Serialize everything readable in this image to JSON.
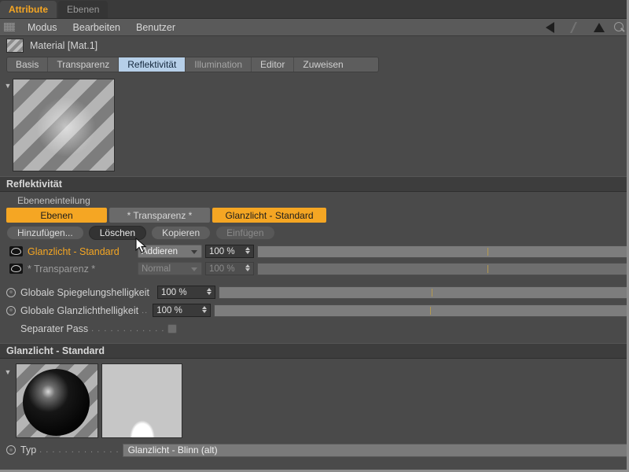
{
  "window": {
    "manager_tabs": [
      {
        "label": "Attribute",
        "active": true
      },
      {
        "label": "Ebenen",
        "active": false
      }
    ]
  },
  "menubar": {
    "grip_icon": "dotted-grip-icon",
    "items": [
      "Modus",
      "Bearbeiten",
      "Benutzer"
    ],
    "right_icons": [
      "triangle-left-icon",
      "ghost-triangle-icon",
      "triangle-up-icon",
      "search-icon"
    ]
  },
  "object_header": {
    "swatch_icon": "material-swatch-icon",
    "title": "Material [Mat.1]"
  },
  "attribute_tabs": [
    {
      "label": "Basis",
      "state": "normal"
    },
    {
      "label": "Transparenz",
      "state": "normal"
    },
    {
      "label": "Reflektivität",
      "state": "selected"
    },
    {
      "label": "Illumination",
      "state": "dim"
    },
    {
      "label": "Editor",
      "state": "normal"
    },
    {
      "label": "Zuweisen",
      "state": "normal"
    }
  ],
  "preview": {
    "caret_icon": "caret-down-icon",
    "thumbnail_name": "material-preview-thumbnail"
  },
  "reflectivity": {
    "section_title": "Reflektivität",
    "layering_label": "Ebeneneinteilung",
    "segments": [
      {
        "label": "Ebenen",
        "style": "orange"
      },
      {
        "label": "* Transparenz *",
        "style": "gray"
      },
      {
        "label": "Glanzlicht - Standard",
        "style": "orange"
      }
    ],
    "buttons": [
      {
        "label": "Hinzufügen...",
        "state": "normal"
      },
      {
        "label": "Löschen",
        "state": "hover"
      },
      {
        "label": "Kopieren",
        "state": "normal"
      },
      {
        "label": "Einfügen",
        "state": "disabled"
      }
    ],
    "layers": [
      {
        "visibility_icon": "eye-icon",
        "name": "Glanzlicht - Standard",
        "name_state": "active",
        "blend_mode": "Addieren",
        "blend_state": "enabled",
        "opacity": "100 %",
        "opacity_state": "enabled"
      },
      {
        "visibility_icon": "eye-icon",
        "name": "* Transparenz *",
        "name_state": "inactive",
        "blend_mode": "Normal",
        "blend_state": "disabled",
        "opacity": "100 %",
        "opacity_state": "disabled"
      }
    ],
    "globals": [
      {
        "label": "Globale Spiegelungshelligkeit",
        "value": "100 %",
        "dots": ""
      },
      {
        "label": "Globale Glanzlichthelligkeit",
        "value": "100 %",
        "dots": ".."
      }
    ],
    "separate_pass": {
      "label": "Separater Pass",
      "dots": ". . . . . . . . . . . .",
      "checked": false
    }
  },
  "specular": {
    "section_title": "Glanzlicht - Standard",
    "caret_icon": "caret-down-icon",
    "sphere_preview_name": "specular-sphere-preview",
    "curve_preview_name": "specular-falloff-curve",
    "type_row": {
      "label": "Typ",
      "dots": ". . . . . . . . . . . . .",
      "value": "Glanzlicht - Blinn (alt)"
    }
  },
  "colors": {
    "accent_orange": "#f5a623",
    "tab_selected_blue": "#b6cfe8",
    "panel_bg": "#4a4a4a",
    "section_bg": "#3d3d3d"
  },
  "cursor": {
    "icon": "arrow-cursor"
  }
}
